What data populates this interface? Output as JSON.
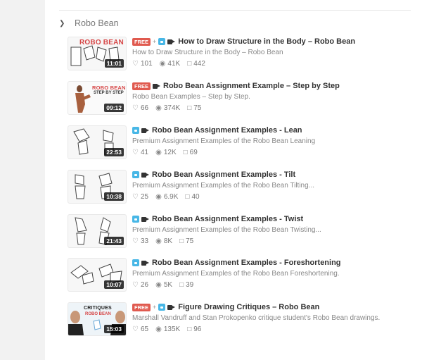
{
  "section": {
    "title": "Robo Bean"
  },
  "labels": {
    "free": "FREE",
    "plus": "+"
  },
  "items": [
    {
      "thumb_title": "ROBO BEAN",
      "thumb_subtitle": "",
      "duration": "11:01",
      "free": true,
      "premium": true,
      "title": "How to Draw Structure in the Body – Robo Bean",
      "description": "How to Draw Structure in the Body – Robo Bean",
      "likes": "101",
      "views": "41K",
      "comments": "442"
    },
    {
      "thumb_title": "ROBO BEAN",
      "thumb_subtitle": "STEP BY STEP",
      "duration": "09:12",
      "free": true,
      "premium": false,
      "title": "Robo Bean Assignment Example – Step by Step",
      "description": "Robo Bean Examples – Step by Step.",
      "likes": "66",
      "views": "374K",
      "comments": "75"
    },
    {
      "thumb_title": "",
      "thumb_subtitle": "",
      "duration": "22:53",
      "free": false,
      "premium": true,
      "title": "Robo Bean Assignment Examples - Lean",
      "description": "Premium Assignment Examples of the Robo Bean Leaning",
      "likes": "41",
      "views": "12K",
      "comments": "69"
    },
    {
      "thumb_title": "",
      "thumb_subtitle": "",
      "duration": "10:38",
      "free": false,
      "premium": true,
      "title": "Robo Bean Assignment Examples - Tilt",
      "description": "Premium Assignment Examples of the Robo Bean Tilting...",
      "likes": "25",
      "views": "6.9K",
      "comments": "40"
    },
    {
      "thumb_title": "",
      "thumb_subtitle": "",
      "duration": "21:43",
      "free": false,
      "premium": true,
      "title": "Robo Bean Assignment Examples - Twist",
      "description": "Premium Assignment Examples of the Robo Bean Twisting...",
      "likes": "33",
      "views": "8K",
      "comments": "75"
    },
    {
      "thumb_title": "",
      "thumb_subtitle": "",
      "duration": "10:07",
      "free": false,
      "premium": true,
      "title": "Robo Bean Assignment Examples - Foreshortening",
      "description": "Premium Assignment Examples of the Robo Bean Foreshortening.",
      "likes": "26",
      "views": "5K",
      "comments": "39"
    },
    {
      "thumb_title": "CRITIQUES",
      "thumb_subtitle": "ROBO BEAN",
      "duration": "15:03",
      "free": true,
      "premium": true,
      "title": "Figure Drawing Critiques – Robo Bean",
      "description": "Marshall Vandruff and Stan Prokopenko critique student's Robo Bean drawings.",
      "likes": "65",
      "views": "135K",
      "comments": "96"
    }
  ],
  "colors": {
    "free_badge": "#e05a4f",
    "premium_badge": "#48b7e6"
  },
  "icons": {
    "like": "heart-icon",
    "views": "eye-icon",
    "comments": "comment-icon",
    "video": "video-camera-icon",
    "lock": "lock-icon",
    "collapse": "chevron-down-icon"
  }
}
